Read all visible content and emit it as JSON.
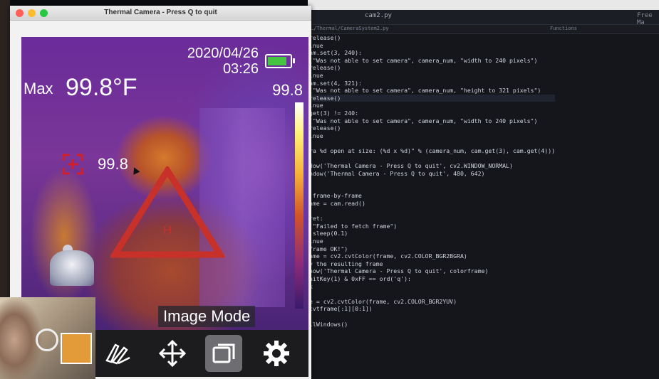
{
  "window": {
    "title": "Thermal Camera - Press Q to quit"
  },
  "thermal": {
    "date": "2020/04/26",
    "time": "03:26",
    "max_label": "Max",
    "max_value": "99.8°F",
    "scale_max": "99.8",
    "spot_value": "99.8",
    "triangle_label": "H",
    "mode_label": "Image Mode",
    "battery_level": 0.85
  },
  "toolbar": {
    "items": [
      {
        "icon": "target-icon"
      },
      {
        "icon": "palette-icon"
      },
      {
        "icon": "move-icon"
      },
      {
        "icon": "image-mode-icon",
        "active": true
      },
      {
        "icon": "gear-icon"
      }
    ]
  },
  "editor": {
    "tab_name": "cam2.py",
    "tab_right": "Free Ma",
    "path": "…/Thermal/CameraSystem2.py",
    "path_right": "Functions",
    "code_lines": [
      "release()",
      "inue",
      "am.set(3, 240):",
      "(\"Was not able to set camera\", camera_num, \"width to 240 pixels\")",
      "release()",
      "inue",
      "am.set(4, 321):",
      "(\"Was not able to set camera\", camera_num, \"height to 321 pixels\")",
      "release()",
      "inue",
      "get(3) != 240:",
      "(\"Was not able to set camera\", camera_num, \"width to 240 pixels\")",
      "release()",
      "inue",
      "",
      "ra %d open at size: (%d x %d)\" % (camera_num, cam.get(3), cam.get(4)))",
      "",
      "dow('Thermal Camera - Press Q to quit', cv2.WINDOW_NORMAL)",
      "ndow('Thermal Camera - Press Q to quit', 480, 642)",
      "",
      "",
      " frame-by-frame",
      "ame = cam.read()",
      "",
      "ret:",
      "(\"Failed to fetch frame\")",
      ".sleep(0.1)",
      "inue",
      "frame OK!\")",
      "ame = cv2.cvtColor(frame, cv2.COLOR_BGR2BGRA)",
      "y the resulting frame",
      "how('Thermal Camera - Press Q to quit', colorframe)",
      "aitKey(1) & 0xFF == ord('q'):",
      "k",
      "",
      "e = cv2.cvtColor(frame, cv2.COLOR_BGR2YUV)",
      "cvtframe[:1][0:1])",
      "",
      "llWindows()"
    ]
  }
}
